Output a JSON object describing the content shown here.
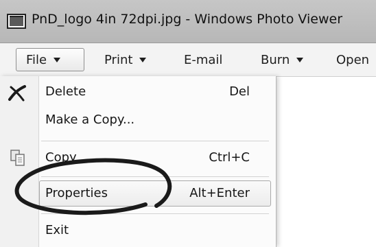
{
  "window": {
    "title": "PnD_logo 4in 72dpi.jpg - Windows Photo Viewer",
    "icon": "photo-viewer-icon"
  },
  "menubar": {
    "items": [
      {
        "label": "File",
        "has_dropdown": true,
        "active": true
      },
      {
        "label": "Print",
        "has_dropdown": true
      },
      {
        "label": "E-mail",
        "has_dropdown": false
      },
      {
        "label": "Burn",
        "has_dropdown": true
      },
      {
        "label": "Open",
        "has_dropdown": false
      }
    ]
  },
  "file_menu": {
    "items": [
      {
        "label": "Delete",
        "shortcut": "Del",
        "icon": "delete-x-icon"
      },
      {
        "label": "Make a Copy...",
        "shortcut": ""
      },
      {
        "label": "Copy",
        "shortcut": "Ctrl+C",
        "icon": "copy-icon"
      },
      {
        "label": "Properties",
        "shortcut": "Alt+Enter",
        "highlighted": true
      },
      {
        "label": "Exit",
        "shortcut": ""
      }
    ]
  },
  "annotation": {
    "type": "hand-drawn-circle",
    "target": "Properties",
    "color": "#1a1a1a"
  }
}
